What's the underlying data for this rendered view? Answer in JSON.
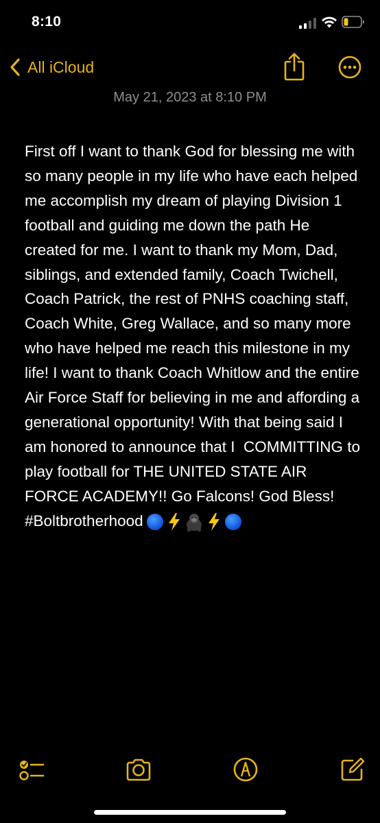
{
  "status_bar": {
    "time": "8:10",
    "icons": [
      "signal-icon",
      "wifi-icon",
      "battery-icon"
    ]
  },
  "nav": {
    "back_label": "All iCloud",
    "back_icon": "chevron-left-icon",
    "share_icon": "share-icon",
    "more_icon": "ellipsis-circle-icon"
  },
  "note": {
    "date": "May 21, 2023 at 8:10 PM",
    "body": "First off I want to thank God for blessing me with so many people in my life who have each helped me accomplish my dream of playing Division 1 football and guiding me down the path He created for me. I want to thank my Mom, Dad, siblings, and extended family, Coach Twichell, Coach Patrick, the rest of PNHS coaching staff, Coach White, Greg Wallace, and so many more who have helped me reach this milestone in my life! I want to thank Coach Whitlow and the entire Air Force Staff for believing in me and affording a generational opportunity! With that being said I am honored to announce that I  COMMITTING to play football for THE UNITED STATE AIR FORCE ACADEMY!! Go Falcons! God Bless! #Boltbrotherhood",
    "emoji_icons": [
      "blue-circle-icon",
      "lightning-icon",
      "gorilla-icon",
      "lightning-icon",
      "blue-circle-icon"
    ]
  },
  "toolbar": {
    "icons": [
      "checklist-icon",
      "camera-icon",
      "markup-pen-icon",
      "compose-icon"
    ]
  },
  "colors": {
    "accent": "#e8b31a",
    "background": "#000000",
    "secondary_text": "#8e8e93"
  }
}
